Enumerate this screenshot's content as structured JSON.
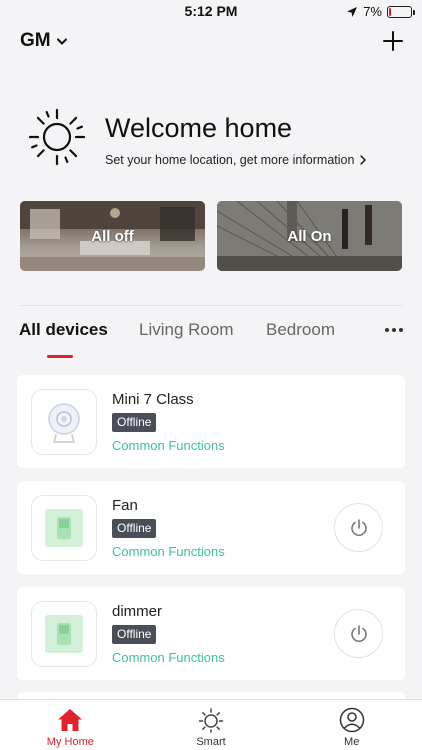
{
  "status_bar": {
    "time": "5:12 PM",
    "battery_text": "7%",
    "battery_level": 0.07,
    "icons": [
      "location-arrow-icon",
      "battery-icon"
    ]
  },
  "header": {
    "home_name": "GM",
    "icons": [
      "chevron-down-icon",
      "plus-icon"
    ]
  },
  "welcome": {
    "title": "Welcome home",
    "subtitle": "Set your home location, get more information",
    "icons": [
      "sun-icon",
      "chevron-right-icon"
    ]
  },
  "scenes": [
    {
      "label": "All off"
    },
    {
      "label": "All On"
    }
  ],
  "tabs": [
    {
      "label": "All devices",
      "active": true
    },
    {
      "label": "Living Room",
      "active": false
    },
    {
      "label": "Bedroom",
      "active": false
    }
  ],
  "devices": [
    {
      "name": "Mini 7 Class",
      "status": "Offline",
      "link": "Common Functions",
      "icon": "camera-icon",
      "has_power": false
    },
    {
      "name": "Fan",
      "status": "Offline",
      "link": "Common Functions",
      "icon": "switch-icon",
      "has_power": true
    },
    {
      "name": "dimmer",
      "status": "Offline",
      "link": "Common Functions",
      "icon": "switch-icon",
      "has_power": true
    }
  ],
  "bottom_nav": [
    {
      "label": "My Home",
      "icon": "home-icon",
      "active": true
    },
    {
      "label": "Smart",
      "icon": "sun-icon",
      "active": false
    },
    {
      "label": "Me",
      "icon": "user-icon",
      "active": false
    }
  ],
  "colors": {
    "accent": "#e3202e",
    "link": "#3cc39a",
    "badge": "#4a4e59",
    "background": "#f4f4f6"
  }
}
